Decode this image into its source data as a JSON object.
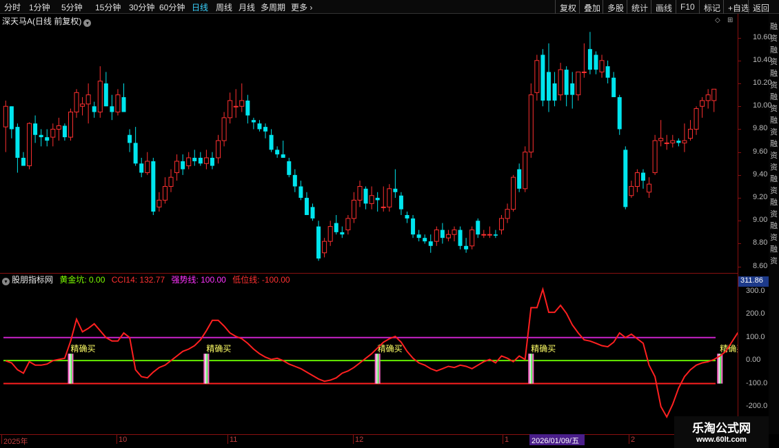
{
  "topbar": {
    "periods": [
      "分时",
      "1分钟",
      "5分钟",
      "15分钟",
      "30分钟",
      "60分钟",
      "日线",
      "周线",
      "月线",
      "多周期",
      "更多"
    ],
    "active_period": "日线",
    "buttons": [
      "复权",
      "叠加",
      "多股",
      "统计",
      "画线",
      "F10",
      "标记",
      "+自选",
      "返回"
    ]
  },
  "stock": {
    "title": "深天马A(日线 前复权)"
  },
  "indicator": {
    "name": "股朋指标网",
    "items": [
      {
        "label": "黄金坑: 0.00",
        "color": "#7cfc00"
      },
      {
        "label": "CCI14: 132.77",
        "color": "#ff3030"
      },
      {
        "label": "强势线: 100.00",
        "color": "#ff33ff"
      },
      {
        "label": "低位线: -100.00",
        "color": "#ff3030"
      }
    ],
    "current_value": "311.86",
    "signal_text": "精确买"
  },
  "price_axis": [
    "10.60",
    "10.40",
    "10.20",
    "10.00",
    "9.80",
    "9.60",
    "9.40",
    "9.20",
    "9.00",
    "8.80",
    "8.60"
  ],
  "sub_axis": [
    "300.0",
    "200.0",
    "100.0",
    "0.00",
    "-100.0",
    "-200.0"
  ],
  "time_axis": [
    "2025年",
    "10",
    "11",
    "12",
    "1",
    "2"
  ],
  "cursor_date": "2026/01/09/五",
  "side_text": [
    "融",
    "资",
    "融",
    "资",
    "融",
    "资",
    "融",
    "资",
    "融",
    "资",
    "融",
    "资",
    "资",
    "融",
    "资",
    "融",
    "资",
    "融",
    "资",
    "融",
    "资"
  ],
  "watermark": {
    "title": "乐淘公式网",
    "url": "www.60lt.com"
  },
  "colors": {
    "up": "#ff3030",
    "down": "#00e5ee",
    "cci": "#ff2020",
    "strong": "#cc22cc",
    "gold": "#66ee00",
    "low": "#ff2020"
  },
  "chart_data": {
    "type": "candlestick",
    "title": "深天马A(日线 前复权)",
    "ylim": [
      8.55,
      10.7
    ],
    "candles": [
      [
        9.82,
        10.05,
        9.6,
        10.0
      ],
      [
        10.0,
        10.0,
        9.72,
        9.8
      ],
      [
        9.82,
        9.85,
        9.42,
        9.55
      ],
      [
        9.55,
        9.6,
        9.48,
        9.48
      ],
      [
        9.48,
        9.86,
        9.45,
        9.85
      ],
      [
        9.85,
        9.92,
        9.68,
        9.75
      ],
      [
        9.75,
        9.8,
        9.65,
        9.73
      ],
      [
        9.73,
        9.8,
        9.65,
        9.7
      ],
      [
        9.73,
        9.85,
        9.65,
        9.8
      ],
      [
        9.8,
        9.9,
        9.7,
        9.83
      ],
      [
        9.83,
        9.85,
        9.7,
        9.73
      ],
      [
        9.73,
        9.98,
        9.7,
        9.95
      ],
      [
        9.95,
        10.15,
        9.9,
        10.12
      ],
      [
        10.0,
        10.08,
        9.92,
        10.02
      ],
      [
        10.02,
        10.2,
        9.85,
        10.1
      ],
      [
        10.0,
        10.04,
        9.9,
        9.95
      ],
      [
        9.95,
        10.35,
        9.9,
        10.22
      ],
      [
        10.2,
        10.3,
        10.0,
        10.0
      ],
      [
        10.0,
        10.1,
        9.88,
        9.95
      ],
      [
        9.95,
        10.15,
        9.92,
        10.1
      ],
      [
        10.08,
        10.2,
        9.95,
        9.95
      ],
      [
        9.75,
        9.8,
        9.6,
        9.68
      ],
      [
        9.68,
        9.82,
        9.48,
        9.5
      ],
      [
        9.5,
        9.55,
        9.38,
        9.42
      ],
      [
        9.42,
        9.6,
        9.4,
        9.52
      ],
      [
        9.52,
        9.55,
        9.05,
        9.08
      ],
      [
        9.12,
        9.25,
        9.08,
        9.18
      ],
      [
        9.18,
        9.38,
        9.15,
        9.3
      ],
      [
        9.3,
        9.45,
        9.25,
        9.38
      ],
      [
        9.42,
        9.58,
        9.35,
        9.52
      ],
      [
        9.52,
        9.58,
        9.4,
        9.45
      ],
      [
        9.48,
        9.6,
        9.45,
        9.55
      ],
      [
        9.55,
        9.62,
        9.48,
        9.52
      ],
      [
        9.55,
        9.6,
        9.48,
        9.5
      ],
      [
        9.5,
        9.62,
        9.45,
        9.55
      ],
      [
        9.55,
        9.6,
        9.45,
        9.48
      ],
      [
        9.55,
        9.75,
        9.5,
        9.7
      ],
      [
        9.7,
        9.95,
        9.65,
        9.9
      ],
      [
        9.9,
        10.12,
        9.85,
        10.05
      ],
      [
        10.0,
        10.15,
        9.9,
        10.0
      ],
      [
        10.0,
        10.2,
        9.95,
        10.05
      ],
      [
        10.05,
        10.1,
        9.85,
        9.92
      ],
      [
        9.88,
        9.9,
        9.8,
        9.86
      ],
      [
        9.85,
        9.88,
        9.78,
        9.8
      ],
      [
        9.82,
        9.85,
        9.72,
        9.78
      ],
      [
        9.75,
        9.8,
        9.6,
        9.62
      ],
      [
        9.62,
        9.65,
        9.55,
        9.58
      ],
      [
        9.58,
        9.7,
        9.55,
        9.55
      ],
      [
        9.52,
        9.55,
        9.38,
        9.4
      ],
      [
        9.4,
        9.45,
        9.25,
        9.3
      ],
      [
        9.3,
        9.35,
        9.18,
        9.2
      ],
      [
        9.2,
        9.25,
        9.05,
        9.05
      ],
      [
        9.12,
        9.15,
        9.0,
        9.02
      ],
      [
        8.95,
        9.0,
        8.65,
        8.67
      ],
      [
        8.72,
        8.85,
        8.68,
        8.82
      ],
      [
        8.82,
        9.0,
        8.78,
        8.95
      ],
      [
        8.98,
        9.05,
        8.88,
        8.9
      ],
      [
        8.9,
        8.95,
        8.85,
        8.88
      ],
      [
        8.92,
        9.05,
        8.88,
        9.02
      ],
      [
        9.02,
        9.25,
        8.98,
        9.18
      ],
      [
        9.18,
        9.35,
        9.12,
        9.3
      ],
      [
        9.28,
        9.3,
        9.1,
        9.15
      ],
      [
        9.15,
        9.3,
        9.1,
        9.22
      ],
      [
        9.2,
        9.25,
        9.08,
        9.18
      ],
      [
        9.12,
        9.3,
        9.08,
        9.12
      ],
      [
        9.12,
        9.32,
        9.08,
        9.28
      ],
      [
        9.28,
        9.45,
        9.2,
        9.25
      ],
      [
        9.22,
        9.25,
        9.05,
        9.1
      ],
      [
        9.05,
        9.08,
        8.98,
        9.02
      ],
      [
        9.02,
        9.05,
        8.85,
        8.88
      ],
      [
        8.88,
        8.92,
        8.82,
        8.85
      ],
      [
        8.85,
        8.88,
        8.8,
        8.82
      ],
      [
        8.82,
        8.88,
        8.72,
        8.78
      ],
      [
        8.82,
        8.95,
        8.78,
        8.92
      ],
      [
        8.92,
        8.98,
        8.8,
        8.85
      ],
      [
        8.85,
        8.92,
        8.82,
        8.88
      ],
      [
        8.88,
        8.95,
        8.82,
        8.92
      ],
      [
        8.92,
        8.95,
        8.75,
        8.78
      ],
      [
        8.78,
        8.85,
        8.72,
        8.75
      ],
      [
        8.78,
        8.95,
        8.75,
        8.92
      ],
      [
        9.0,
        9.02,
        8.85,
        8.88
      ],
      [
        8.88,
        8.92,
        8.85,
        8.88
      ],
      [
        8.88,
        8.95,
        8.85,
        8.88
      ],
      [
        8.88,
        8.92,
        8.85,
        8.87
      ],
      [
        8.92,
        9.05,
        8.88,
        9.02
      ],
      [
        9.02,
        9.15,
        8.98,
        9.1
      ],
      [
        9.1,
        9.4,
        9.08,
        9.38
      ],
      [
        9.45,
        9.5,
        9.25,
        9.28
      ],
      [
        9.28,
        9.65,
        9.25,
        9.6
      ],
      [
        9.6,
        10.2,
        9.55,
        10.1
      ],
      [
        10.12,
        10.45,
        10.05,
        10.4
      ],
      [
        10.45,
        10.5,
        10.0,
        10.05
      ],
      [
        10.3,
        10.55,
        9.95,
        10.05
      ],
      [
        10.2,
        10.3,
        10.0,
        10.05
      ],
      [
        10.1,
        10.38,
        10.05,
        10.32
      ],
      [
        10.32,
        10.35,
        10.0,
        10.1
      ],
      [
        10.2,
        10.3,
        9.98,
        10.1
      ],
      [
        10.1,
        10.3,
        10.05,
        10.3
      ],
      [
        10.3,
        10.55,
        10.25,
        10.3
      ],
      [
        10.5,
        10.65,
        10.28,
        10.32
      ],
      [
        10.45,
        10.48,
        10.28,
        10.32
      ],
      [
        10.3,
        10.45,
        10.25,
        10.4
      ],
      [
        10.35,
        10.4,
        10.2,
        10.25
      ],
      [
        10.25,
        10.3,
        10.1,
        10.08
      ],
      [
        10.08,
        10.1,
        9.75,
        9.8
      ],
      [
        9.62,
        9.65,
        9.1,
        9.12
      ],
      [
        9.22,
        9.35,
        9.2,
        9.3
      ],
      [
        9.3,
        9.45,
        9.25,
        9.42
      ],
      [
        9.42,
        9.45,
        9.28,
        9.35
      ],
      [
        9.25,
        9.38,
        9.2,
        9.32
      ],
      [
        9.42,
        9.75,
        9.4,
        9.7
      ],
      [
        9.7,
        9.88,
        9.65,
        9.72
      ],
      [
        9.68,
        9.75,
        9.62,
        9.68
      ],
      [
        9.68,
        9.75,
        9.64,
        9.7
      ],
      [
        9.7,
        9.72,
        9.65,
        9.68
      ],
      [
        9.68,
        9.85,
        9.6,
        9.7
      ],
      [
        9.72,
        9.88,
        9.7,
        9.8
      ],
      [
        9.8,
        10.0,
        9.75,
        9.98
      ],
      [
        10.0,
        10.08,
        9.9,
        10.05
      ],
      [
        10.05,
        10.15,
        9.98,
        10.1
      ],
      [
        10.05,
        10.15,
        9.95,
        10.15
      ]
    ],
    "cci": [
      -1,
      -10,
      -40,
      -55,
      -5,
      -20,
      -20,
      -15,
      0,
      5,
      10,
      85,
      180,
      125,
      140,
      160,
      130,
      100,
      85,
      85,
      120,
      100,
      -40,
      -70,
      -75,
      -50,
      -30,
      -20,
      0,
      20,
      40,
      50,
      65,
      90,
      130,
      175,
      175,
      150,
      120,
      105,
      95,
      75,
      50,
      30,
      15,
      5,
      10,
      0,
      -15,
      -25,
      -35,
      -50,
      -65,
      -80,
      -90,
      -85,
      -75,
      -55,
      -45,
      -30,
      -10,
      10,
      30,
      55,
      80,
      95,
      105,
      80,
      40,
      10,
      -10,
      -20,
      -35,
      -45,
      -35,
      -25,
      -30,
      -20,
      -25,
      -35,
      -20,
      -5,
      5,
      -10,
      20,
      10,
      -5,
      20,
      5,
      230,
      230,
      310,
      210,
      210,
      240,
      205,
      155,
      120,
      90,
      85,
      75,
      65,
      60,
      80,
      120,
      100,
      115,
      95,
      75,
      -20,
      -70,
      -200,
      -245,
      -190,
      -120,
      -70,
      -40,
      -20,
      -10,
      -5,
      5,
      20,
      40,
      80,
      120,
      130,
      135,
      135
    ],
    "strong_line": 100,
    "low_line": -100,
    "gold_pit": 0,
    "signal_indices": [
      11,
      34,
      63,
      89,
      121
    ],
    "sub_ylim": [
      -320,
      330
    ]
  }
}
